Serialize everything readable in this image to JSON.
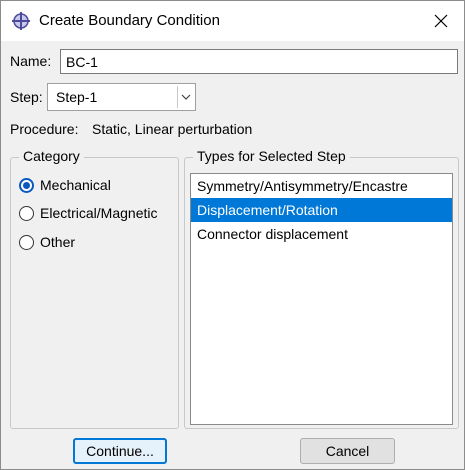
{
  "window": {
    "title": "Create Boundary Condition"
  },
  "name_field": {
    "label": "Name:",
    "value": "BC-1"
  },
  "step_field": {
    "label": "Step:",
    "value": "Step-1"
  },
  "procedure": {
    "label": "Procedure:",
    "value": "Static, Linear perturbation"
  },
  "category": {
    "title": "Category",
    "options": [
      {
        "label": "Mechanical",
        "checked": true
      },
      {
        "label": "Electrical/Magnetic",
        "checked": false
      },
      {
        "label": "Other",
        "checked": false
      }
    ]
  },
  "types": {
    "title": "Types for Selected Step",
    "items": [
      {
        "label": "Symmetry/Antisymmetry/Encastre",
        "selected": false
      },
      {
        "label": "Displacement/Rotation",
        "selected": true
      },
      {
        "label": "Connector displacement",
        "selected": false
      }
    ]
  },
  "buttons": {
    "continue": "Continue...",
    "cancel": "Cancel"
  },
  "colors": {
    "accent": "#0078d7",
    "radio_accent": "#0a58c2"
  },
  "icons": {
    "app": "crosshair-icon",
    "close": "close-icon",
    "dropdown": "chevron-down-icon"
  }
}
